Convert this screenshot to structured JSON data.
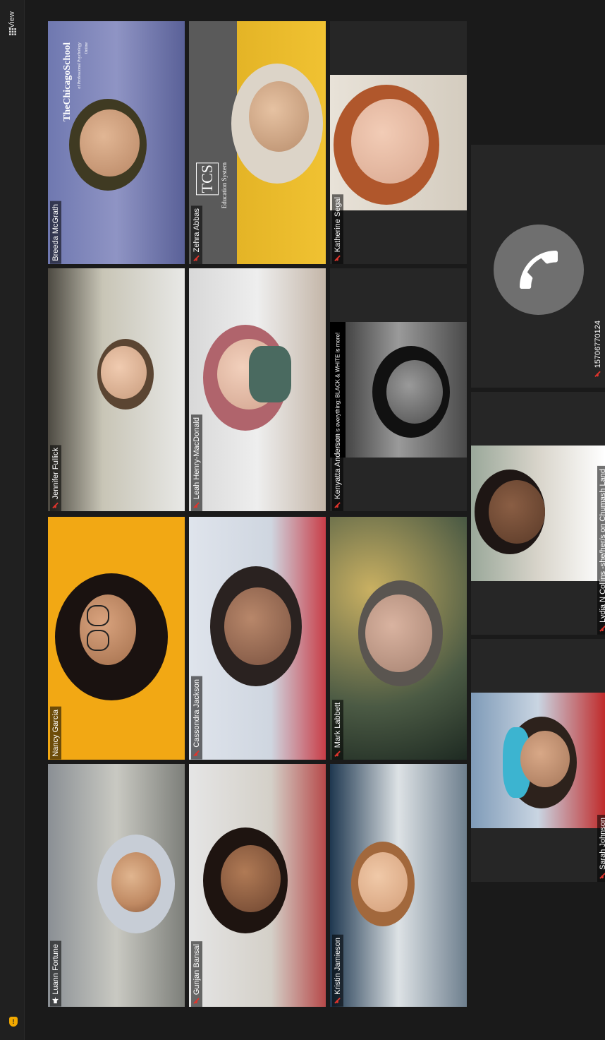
{
  "toolbar": {
    "view_label": "View"
  },
  "participants": [
    {
      "name": "Luann Fortune",
      "icon": "pin-icon"
    },
    {
      "name": "Gunjan Bansal",
      "icon": "mic-muted-icon"
    },
    {
      "name": "Kristin Jamieson",
      "icon": "mic-muted-icon"
    },
    {
      "name": "Nancy Garcia",
      "icon": "none"
    },
    {
      "name": "Cassondra Jackson",
      "icon": "mic-muted-icon"
    },
    {
      "name": "Mark Labbett",
      "icon": "mic-muted-icon"
    },
    {
      "name": "Jennifer Fullick",
      "icon": "mic-muted-icon"
    },
    {
      "name": "Leah Henry-MacDonald",
      "icon": "mic-muted-icon"
    },
    {
      "name": "Kenyatta Anderson",
      "icon": "mic-muted-icon"
    },
    {
      "name": "Breeda McGrath",
      "icon": "none"
    },
    {
      "name": "Zehra Abbas",
      "icon": "mic-muted-icon"
    },
    {
      "name": "Katherine Segal",
      "icon": "mic-muted-icon"
    },
    {
      "name": "Sarah Johnson",
      "icon": "mic-muted-icon"
    },
    {
      "name": "Lydia N Collins -she/her/s on Chumash Land",
      "icon": "mic-muted-icon"
    },
    {
      "name": "15706770124",
      "icon": "mic-muted-icon"
    }
  ],
  "backgrounds": {
    "tcs_logo": "TCS",
    "tcs_subtitle": "Education System",
    "chicago_school": "TheChicagoSchool",
    "chicago_school_sub": "of Professional Psychology",
    "chicago_school_online": "Online",
    "bw_banner": "Color is everything; BLACK & WHITE is more!"
  },
  "colors": {
    "active_speaker": "#a8e12d",
    "muted": "#e0342c",
    "tile_bg": "#262626"
  }
}
